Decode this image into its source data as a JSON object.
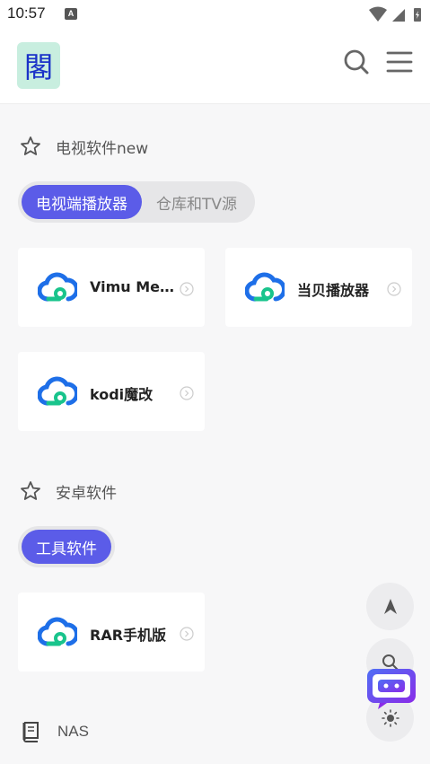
{
  "status_bar": {
    "time": "10:57",
    "notification_icon": "A"
  },
  "header": {
    "logo_char": "閣"
  },
  "sections": [
    {
      "title": "电视软件new",
      "tabs": [
        "电视端播放器",
        "仓库和TV源"
      ],
      "active_tab": 0,
      "cards": [
        "Vimu Media Player",
        "当贝播放器",
        "kodi魔改"
      ]
    },
    {
      "title": "安卓软件",
      "tabs": [
        "工具软件"
      ],
      "active_tab": 0,
      "cards": [
        "RAR手机版"
      ]
    }
  ],
  "nas": {
    "title": "NAS"
  },
  "colors": {
    "accent": "#5b5ce8",
    "cloud_blue": "#1e6fe8",
    "cloud_green": "#19c48c",
    "chat_purple": "#6a3cf0"
  },
  "icons": [
    "star-icon",
    "cloud-icon",
    "search-icon",
    "menu-icon",
    "navigate-icon",
    "sun-icon",
    "book-icon",
    "chat-bot-icon",
    "arrow-circle-icon"
  ]
}
